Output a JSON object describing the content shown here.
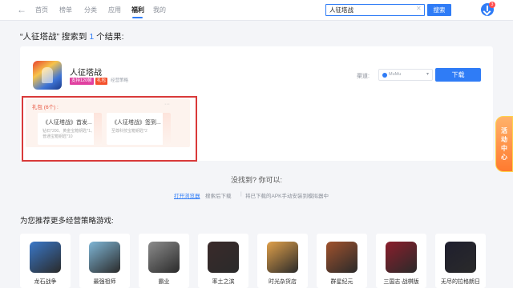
{
  "nav": {
    "back_icon": "arrow-left-icon",
    "items": [
      {
        "label": "首页"
      },
      {
        "label": "榜单"
      },
      {
        "label": "分类"
      },
      {
        "label": "应用"
      },
      {
        "label": "福利",
        "active": true
      },
      {
        "label": "我的"
      }
    ],
    "search": {
      "value": "人征塔战",
      "button": "搜索"
    },
    "download_badge": "3"
  },
  "results": {
    "prefix": "“人征塔战” 搜索到 ",
    "count": "1",
    "suffix": " 个结果:"
  },
  "game": {
    "name": "人征塔战",
    "tags": [
      "支持120帧",
      "礼包",
      "经营策略"
    ],
    "channel_label": "渠道:",
    "channel_value": "MuMu",
    "download": "下载"
  },
  "gifts": {
    "title": "礼包 (6个) :",
    "more": "···",
    "items": [
      {
        "name": "《人征塔战》首发...",
        "desc": "钻石*200、黄金宝箱钥匙*1、普通宝箱钥匙*10"
      },
      {
        "name": "《人征塔战》签到...",
        "desc": "至尊科技宝箱钥匙*2"
      }
    ]
  },
  "not_found": {
    "title": "没找到? 你可以:",
    "link": "打开浏览器",
    "text1": "搜索后下载",
    "sep": "|",
    "text2": "将已下载的APK手动安装到模拟器中"
  },
  "recommend": {
    "title": "为您推荐更多经营策略游戏:",
    "items": [
      {
        "name": "龙石战争",
        "color": "#3a78c9"
      },
      {
        "name": "最强祖师",
        "color": "#7fb6d6"
      },
      {
        "name": "霸业",
        "color": "#8c8c8c"
      },
      {
        "name": "率土之滨",
        "color": "#3a2a2a"
      },
      {
        "name": "时光杂货店",
        "color": "#e0a04a"
      },
      {
        "name": "群星纪元",
        "color": "#a0522d"
      },
      {
        "name": "三国志·战棋版",
        "color": "#8b1e2c"
      },
      {
        "name": "无尽的拉格朗日",
        "color": "#1f1f2e"
      }
    ]
  },
  "activity": {
    "label": "活动中心"
  }
}
